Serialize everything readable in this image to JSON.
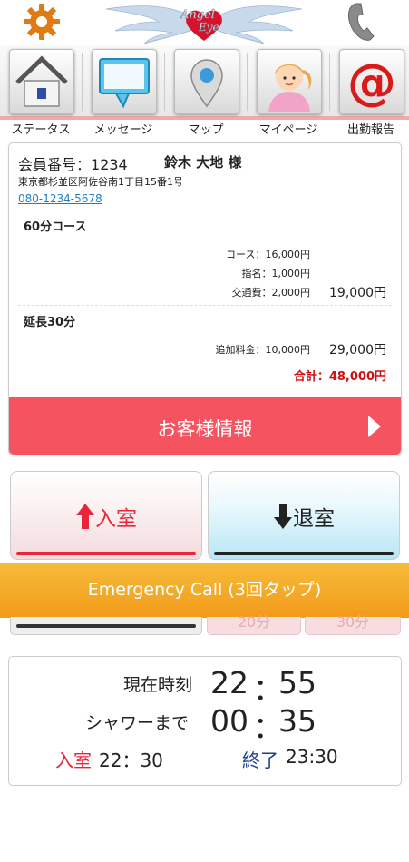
{
  "header": {
    "logo_text": "Angel Eye",
    "settings_icon": "gear-icon",
    "phone_icon": "phone-icon"
  },
  "nav": {
    "items": [
      {
        "label": "ステータス",
        "icon": "home-icon"
      },
      {
        "label": "メッセージ",
        "icon": "speech-bubble-icon"
      },
      {
        "label": "マップ",
        "icon": "map-pin-icon"
      },
      {
        "label": "マイページ",
        "icon": "girl-avatar-icon"
      },
      {
        "label": "出勤報告",
        "icon": "at-sign-icon"
      }
    ],
    "accent_color": "#f2a9ae"
  },
  "customer": {
    "member_label": "会員番号：",
    "member_number": "1234",
    "name": "鈴木 大地 様",
    "address": "東京都杉並区阿佐谷南1丁目15番1号",
    "phone": "080-1234-5678",
    "course": {
      "title": "60分コース",
      "lines": [
        "コース：16,000円",
        "指名：1,000円",
        "交通費：2,000円"
      ],
      "subtotal": "19,000円"
    },
    "extension": {
      "title": "延長30分",
      "line": "追加料金：10,000円",
      "subtotal": "29,000円"
    },
    "total": "合計：48,000円",
    "info_button": "お客様情報"
  },
  "actions": {
    "enter_label": "入室",
    "exit_label": "退室",
    "enter_color": "#e8253b",
    "exit_color": "#222222"
  },
  "emergency": {
    "label": "Emergency Call (3回タップ)"
  },
  "hidden_buttons": {
    "ext_20": "20分",
    "ext_30": "30分"
  },
  "time": {
    "current_label": "現在時刻",
    "current_hour": "22",
    "current_minute": "55",
    "shower_label": "シャワーまで",
    "shower_hour": "00",
    "shower_minute": "35",
    "separator": "：",
    "enter_label": "入室",
    "enter_time": "22：30",
    "end_label": "終了",
    "end_time": "23:30"
  }
}
